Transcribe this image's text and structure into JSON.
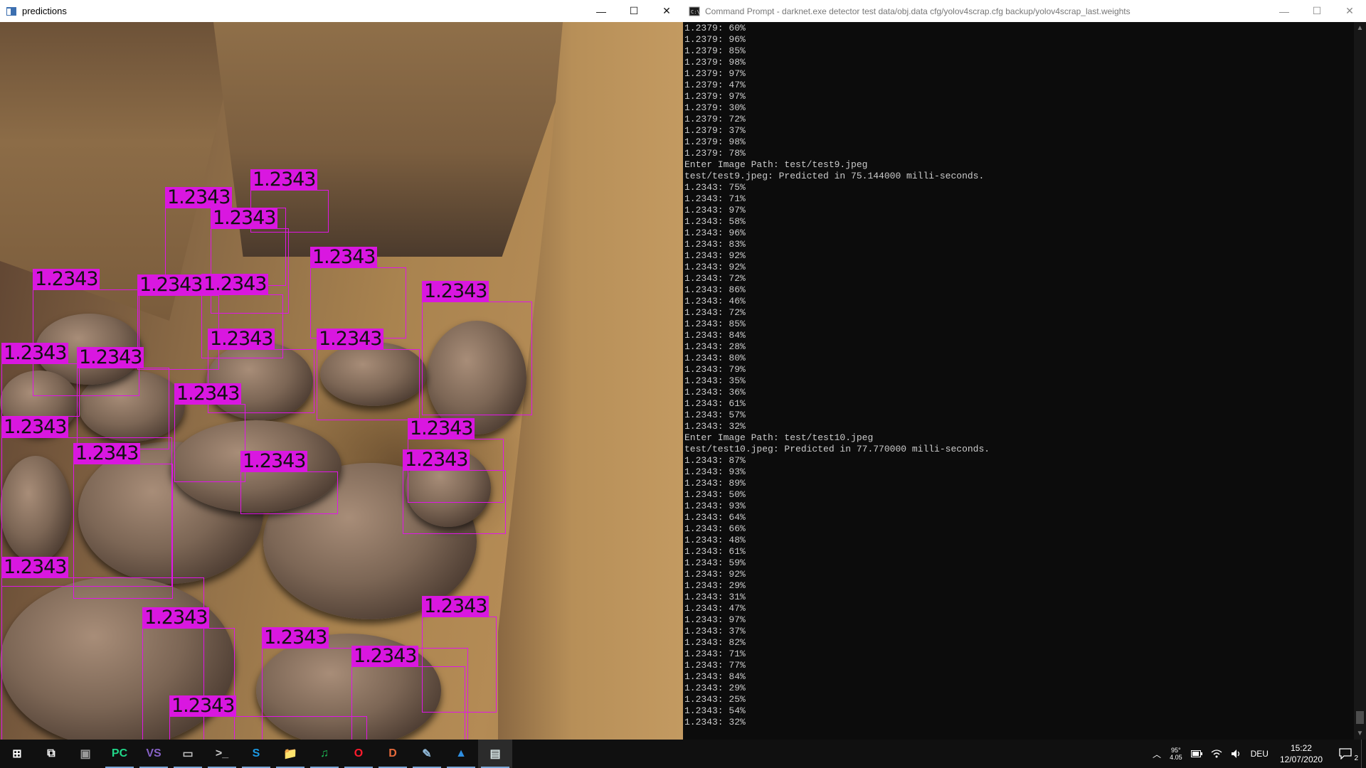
{
  "pred_window": {
    "title": "predictions",
    "controls": {
      "minimize": "—",
      "maximize": "☐",
      "close": "✕"
    },
    "detections": [
      {
        "label": "1.2343"
      },
      {
        "label": "1.2343"
      },
      {
        "label": "1.2343"
      },
      {
        "label": "1.2343"
      },
      {
        "label": "1.2343"
      },
      {
        "label": "1.2343"
      },
      {
        "label": "1.2343"
      },
      {
        "label": "1.2343"
      },
      {
        "label": "1.2343"
      },
      {
        "label": "1.2343"
      },
      {
        "label": "1.2343"
      },
      {
        "label": "1.2343"
      },
      {
        "label": "1.2343"
      },
      {
        "label": "1.2343"
      },
      {
        "label": "1.2343"
      },
      {
        "label": "1.2343"
      },
      {
        "label": "1.2343"
      },
      {
        "label": "1.2343"
      },
      {
        "label": "1.2343"
      },
      {
        "label": "1.2343"
      },
      {
        "label": "1.2343"
      },
      {
        "label": "1.2343"
      },
      {
        "label": "1.2343"
      },
      {
        "label": "1.2343"
      }
    ]
  },
  "cmd_window": {
    "title": "Command Prompt - darknet.exe  detector test data/obj.data cfg/yolov4scrap.cfg backup/yolov4scrap_last.weights",
    "controls": {
      "minimize": "—",
      "maximize": "☐",
      "close": "✕"
    },
    "lines": [
      "1.2379: 60%",
      "1.2379: 96%",
      "1.2379: 85%",
      "1.2379: 98%",
      "1.2379: 97%",
      "1.2379: 47%",
      "1.2379: 97%",
      "1.2379: 30%",
      "1.2379: 72%",
      "1.2379: 37%",
      "1.2379: 98%",
      "1.2379: 78%",
      "Enter Image Path: test/test9.jpeg",
      "test/test9.jpeg: Predicted in 75.144000 milli-seconds.",
      "1.2343: 75%",
      "1.2343: 71%",
      "1.2343: 97%",
      "1.2343: 58%",
      "1.2343: 96%",
      "1.2343: 83%",
      "1.2343: 92%",
      "1.2343: 92%",
      "1.2343: 72%",
      "1.2343: 86%",
      "1.2343: 46%",
      "1.2343: 72%",
      "1.2343: 85%",
      "1.2343: 84%",
      "1.2343: 28%",
      "1.2343: 80%",
      "1.2343: 79%",
      "1.2343: 35%",
      "1.2343: 36%",
      "1.2343: 61%",
      "1.2343: 57%",
      "1.2343: 32%",
      "Enter Image Path: test/test10.jpeg",
      "test/test10.jpeg: Predicted in 77.770000 milli-seconds.",
      "1.2343: 87%",
      "1.2343: 93%",
      "1.2343: 89%",
      "1.2343: 50%",
      "1.2343: 93%",
      "1.2343: 64%",
      "1.2343: 66%",
      "1.2343: 48%",
      "1.2343: 61%",
      "1.2343: 59%",
      "1.2343: 92%",
      "1.2343: 29%",
      "1.2343: 31%",
      "1.2343: 47%",
      "1.2343: 97%",
      "1.2343: 37%",
      "1.2343: 82%",
      "1.2343: 71%",
      "1.2343: 77%",
      "1.2343: 84%",
      "1.2343: 29%",
      "1.2343: 25%",
      "1.2343: 54%",
      "1.2343: 32%"
    ]
  },
  "taskbar": {
    "apps": [
      {
        "name": "start-icon",
        "glyph": "⊞",
        "color": "#ffffff"
      },
      {
        "name": "task-view-icon",
        "glyph": "⧉",
        "color": "#ffffff"
      },
      {
        "name": "app-window-icon",
        "glyph": "▣",
        "color": "#9a9a9a"
      },
      {
        "name": "pycharm-icon",
        "glyph": "PC",
        "color": "#21d789"
      },
      {
        "name": "visual-studio-icon",
        "glyph": "VS",
        "color": "#8661c5"
      },
      {
        "name": "window-app-icon",
        "glyph": "▭",
        "color": "#c0c0c0"
      },
      {
        "name": "terminal-icon",
        "glyph": ">_",
        "color": "#cccccc"
      },
      {
        "name": "steam-icon",
        "glyph": "S",
        "color": "#1b9ae5"
      },
      {
        "name": "file-explorer-icon",
        "glyph": "📁",
        "color": "#f4c542"
      },
      {
        "name": "spotify-icon",
        "glyph": "♫",
        "color": "#1db954"
      },
      {
        "name": "opera-icon",
        "glyph": "O",
        "color": "#ff1b2d"
      },
      {
        "name": "discord-icon",
        "glyph": "D",
        "color": "#e56a3b"
      },
      {
        "name": "notes-app-icon",
        "glyph": "✎",
        "color": "#8fb8d8"
      },
      {
        "name": "photos-icon",
        "glyph": "▲",
        "color": "#2f8ee0"
      },
      {
        "name": "predictions-app-icon",
        "glyph": "▤",
        "color": "#d9e7e7"
      }
    ],
    "tray": {
      "chevron": "︿",
      "cpu": "95°\n4.05",
      "language": "DEU",
      "time": "15:22",
      "date": "12/07/2020",
      "notifications": "2"
    }
  }
}
